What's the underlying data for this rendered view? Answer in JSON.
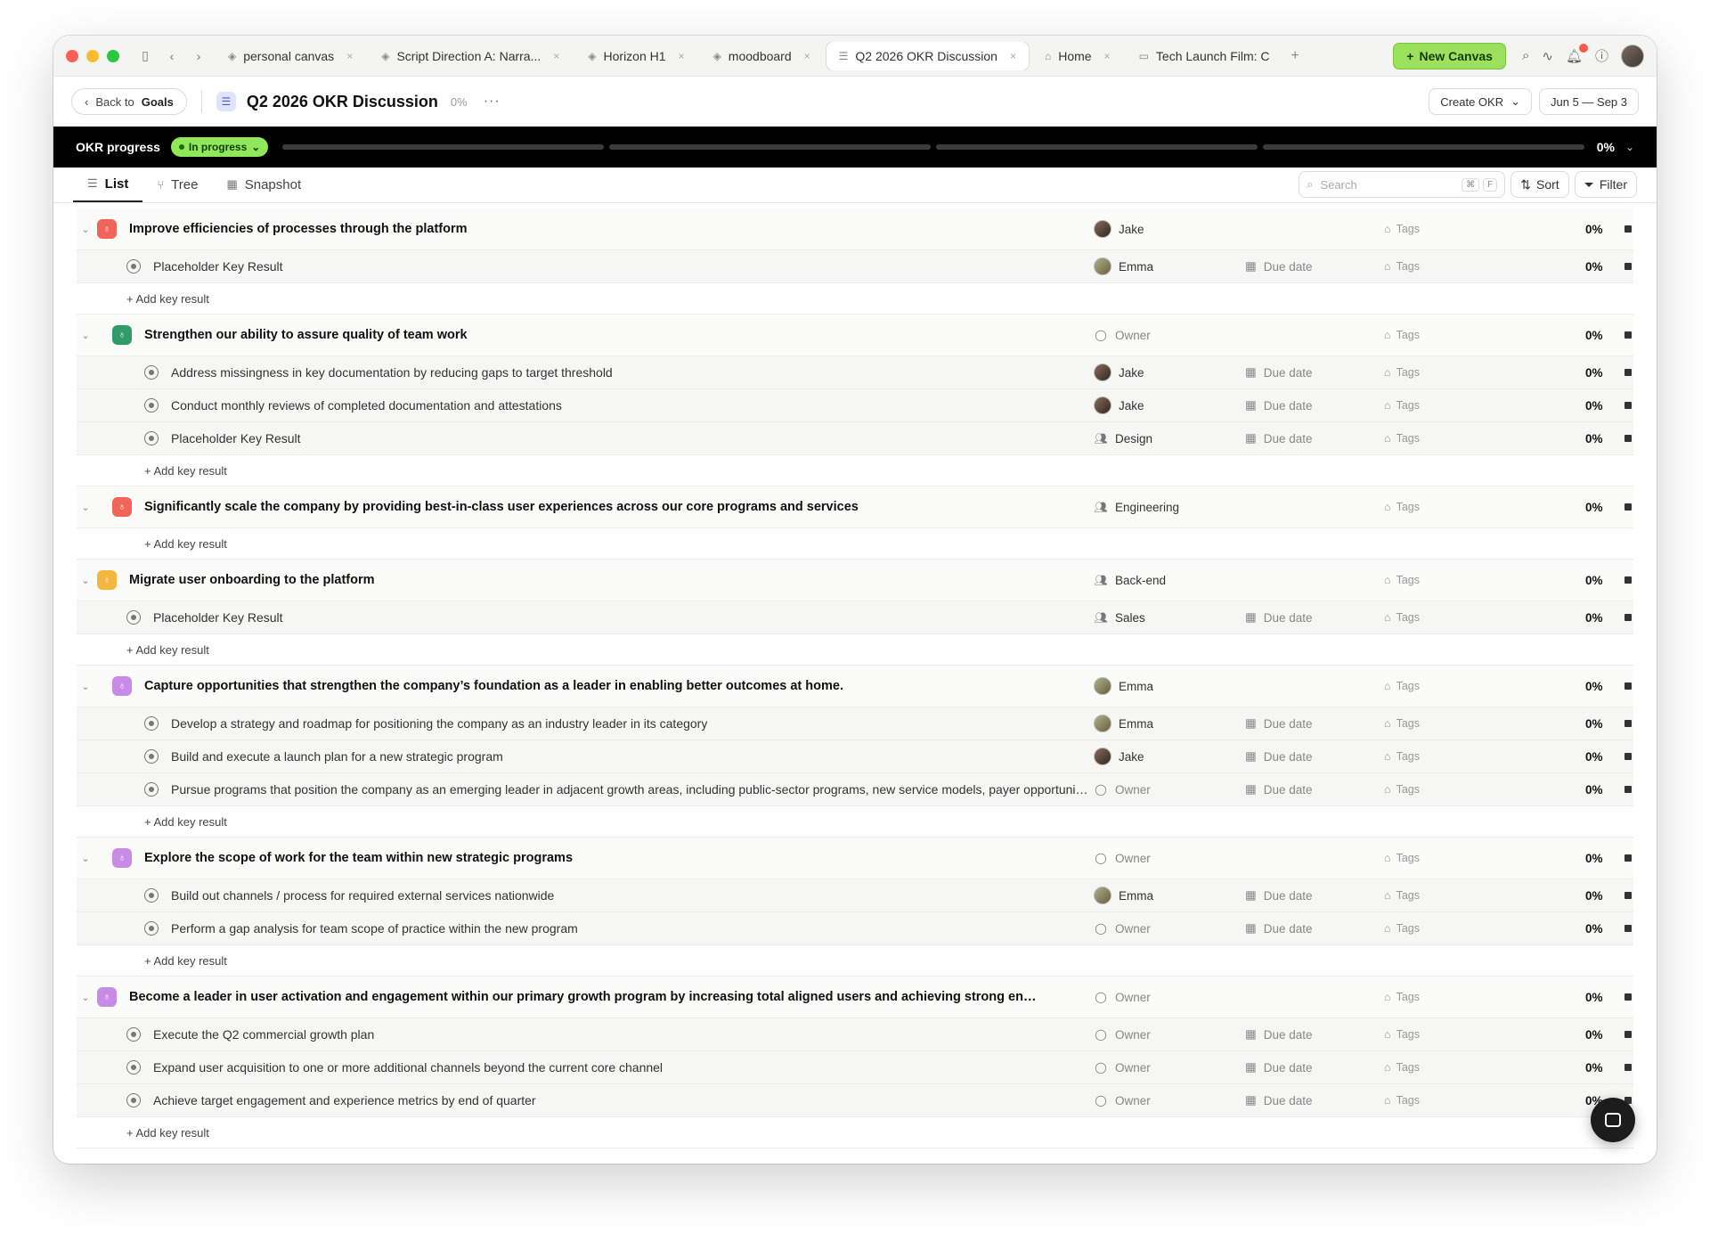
{
  "tabs": [
    {
      "label": "personal canvas",
      "icon": "layers-icon",
      "active": false
    },
    {
      "label": "Script Direction A: Narra...",
      "icon": "layers-icon",
      "active": false
    },
    {
      "label": "Horizon H1",
      "icon": "layers-icon",
      "active": false
    },
    {
      "label": "moodboard",
      "icon": "layers-icon",
      "active": false
    },
    {
      "label": "Q2 2026 OKR Discussion",
      "icon": "okr-icon",
      "active": true
    },
    {
      "label": "Home",
      "icon": "home-icon",
      "active": false
    },
    {
      "label": "Tech Launch Film: C",
      "icon": "folder-icon",
      "active": false
    }
  ],
  "toolbar": {
    "new_canvas_label": "New Canvas"
  },
  "header": {
    "back_prefix": "Back to",
    "back_target": "Goals",
    "title": "Q2 2026 OKR Discussion",
    "progress": "0%",
    "create_label": "Create OKR",
    "date_range": "Jun 5 — Sep 3"
  },
  "band": {
    "label": "OKR progress",
    "status": "In progress",
    "progress": "0%",
    "segments": [
      0,
      0,
      0,
      0
    ]
  },
  "views": {
    "list": "List",
    "tree": "Tree",
    "snapshot": "Snapshot",
    "search_placeholder": "Search",
    "kbd1": "⌘",
    "kbd2": "F",
    "sort": "Sort",
    "filter": "Filter"
  },
  "labels": {
    "due": "Due date",
    "tags": "Tags",
    "add_kr": "+ Add key result",
    "owner_placeholder": "Owner"
  },
  "colors": {
    "red": "#f0645a",
    "green": "#2f9d67",
    "yellow": "#f4b63e",
    "purple": "#c98be8",
    "accent": "#8ee85a"
  },
  "objectives": [
    {
      "title": "Improve efficiencies of processes through the platform",
      "color": "red",
      "nested": false,
      "owner": {
        "name": "Jake",
        "type": "jake"
      },
      "pct": "0%",
      "krs": [
        {
          "title": "Placeholder Key Result",
          "owner": {
            "name": "Emma",
            "type": "emma"
          },
          "pct": "0%"
        }
      ]
    },
    {
      "title": "Strengthen our ability to assure quality of team work",
      "color": "green",
      "nested": true,
      "owner": {
        "name": "Owner",
        "type": "none"
      },
      "pct": "0%",
      "krs": [
        {
          "title": "Address missingness in key documentation by reducing gaps to target threshold",
          "owner": {
            "name": "Jake",
            "type": "jake"
          },
          "pct": "0%"
        },
        {
          "title": "Conduct monthly reviews of completed documentation and attestations",
          "owner": {
            "name": "Jake",
            "type": "jake"
          },
          "pct": "0%"
        },
        {
          "title": "Placeholder Key Result",
          "owner": {
            "name": "Design",
            "type": "team"
          },
          "pct": "0%"
        }
      ]
    },
    {
      "title": "Significantly scale the company by providing best-in-class user experiences across our core programs and services",
      "color": "red",
      "nested": true,
      "owner": {
        "name": "Engineering",
        "type": "team"
      },
      "pct": "0%",
      "krs": []
    },
    {
      "title": "Migrate user onboarding to the platform",
      "color": "yellow",
      "nested": false,
      "owner": {
        "name": "Back-end",
        "type": "team"
      },
      "pct": "0%",
      "krs": [
        {
          "title": "Placeholder Key Result",
          "owner": {
            "name": "Sales",
            "type": "team"
          },
          "pct": "0%"
        }
      ]
    },
    {
      "title": "Capture opportunities that strengthen the company’s foundation as a leader in enabling better outcomes at home.",
      "color": "purple",
      "nested": true,
      "owner": {
        "name": "Emma",
        "type": "emma"
      },
      "pct": "0%",
      "krs": [
        {
          "title": "Develop a strategy and roadmap for positioning the company as an industry leader in its category",
          "owner": {
            "name": "Emma",
            "type": "emma"
          },
          "pct": "0%"
        },
        {
          "title": "Build and execute a launch plan for a new strategic program",
          "owner": {
            "name": "Jake",
            "type": "jake"
          },
          "pct": "0%"
        },
        {
          "title": "Pursue programs that position the company as an emerging leader in adjacent growth areas, including public-sector programs, new service models, payer opportunitie...",
          "owner": {
            "name": "Owner",
            "type": "none"
          },
          "pct": "0%"
        }
      ]
    },
    {
      "title": "Explore the scope of work for the team within new strategic programs",
      "color": "purple",
      "nested": true,
      "owner": {
        "name": "Owner",
        "type": "none"
      },
      "pct": "0%",
      "krs": [
        {
          "title": "Build out channels / process for required external services nationwide",
          "owner": {
            "name": "Emma",
            "type": "emma"
          },
          "pct": "0%"
        },
        {
          "title": "Perform a gap analysis for team scope of practice within the new program",
          "owner": {
            "name": "Owner",
            "type": "none"
          },
          "pct": "0%"
        }
      ]
    },
    {
      "title": "Become a leader in user activation and engagement within our primary growth program by increasing total aligned users and achieving strong engagem...",
      "color": "purple",
      "nested": false,
      "owner": {
        "name": "Owner",
        "type": "none"
      },
      "pct": "0%",
      "krs": [
        {
          "title": "Execute the Q2 commercial growth plan",
          "owner": {
            "name": "Owner",
            "type": "none"
          },
          "pct": "0%"
        },
        {
          "title": "Expand user acquisition to one or more additional channels beyond the current core channel",
          "owner": {
            "name": "Owner",
            "type": "none"
          },
          "pct": "0%"
        },
        {
          "title": "Achieve target engagement and experience metrics by end of quarter",
          "owner": {
            "name": "Owner",
            "type": "none"
          },
          "pct": "0%"
        }
      ]
    }
  ]
}
